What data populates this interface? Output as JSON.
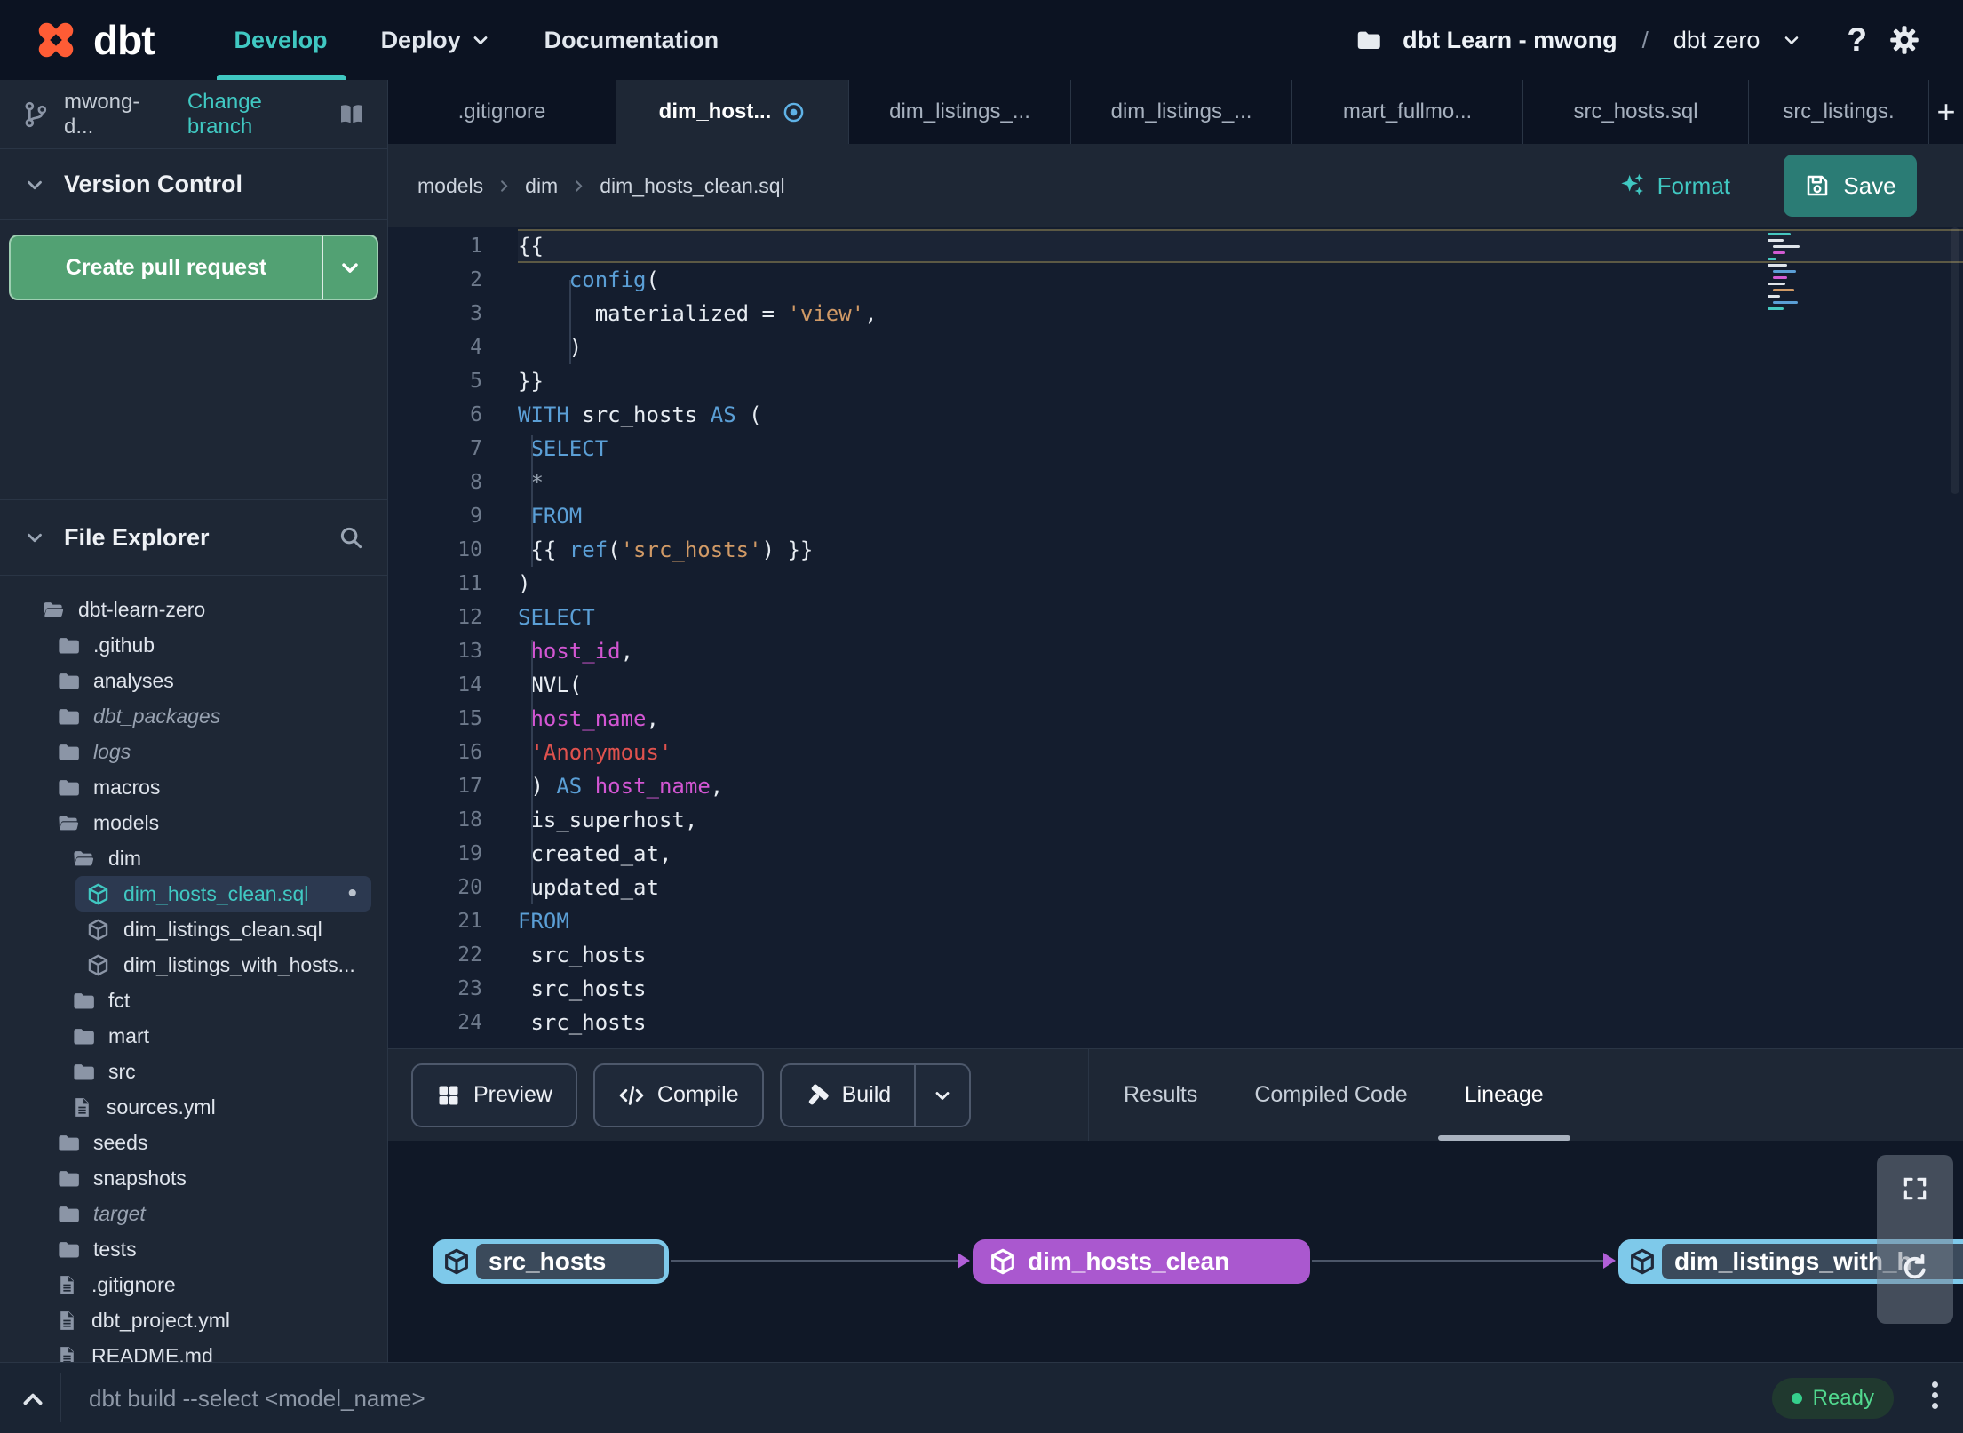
{
  "topnav": {
    "logo": "dbt",
    "menu": [
      {
        "label": "Develop",
        "active": true
      },
      {
        "label": "Deploy",
        "has_dropdown": true
      },
      {
        "label": "Documentation"
      }
    ],
    "project": {
      "icon": "folder-icon",
      "name": "dbt Learn - mwong",
      "separator": "/",
      "environment": "dbt zero"
    },
    "help_label": "?"
  },
  "sidebar": {
    "branch": {
      "icon": "git-branch-icon",
      "name": "mwong-d...",
      "change_label": "Change branch"
    },
    "version_control": {
      "title": "Version Control",
      "create_pr_label": "Create pull request"
    },
    "file_explorer": {
      "title": "File Explorer",
      "tree": [
        {
          "label": "dbt-learn-zero",
          "icon": "folder-open-icon",
          "depth": 0
        },
        {
          "label": ".github",
          "icon": "folder-icon",
          "depth": 1
        },
        {
          "label": "analyses",
          "icon": "folder-icon",
          "depth": 1
        },
        {
          "label": "dbt_packages",
          "icon": "folder-icon",
          "depth": 1,
          "italic": true
        },
        {
          "label": "logs",
          "icon": "folder-icon",
          "depth": 1,
          "italic": true
        },
        {
          "label": "macros",
          "icon": "folder-icon",
          "depth": 1
        },
        {
          "label": "models",
          "icon": "folder-open-icon",
          "depth": 1
        },
        {
          "label": "dim",
          "icon": "folder-open-icon",
          "depth": 2
        },
        {
          "label": "dim_hosts_clean.sql",
          "icon": "model-icon",
          "depth": 3,
          "selected": true,
          "modified": true
        },
        {
          "label": "dim_listings_clean.sql",
          "icon": "model-icon",
          "depth": 3
        },
        {
          "label": "dim_listings_with_hosts...",
          "icon": "model-icon",
          "depth": 3
        },
        {
          "label": "fct",
          "icon": "folder-icon",
          "depth": 2
        },
        {
          "label": "mart",
          "icon": "folder-icon",
          "depth": 2
        },
        {
          "label": "src",
          "icon": "folder-icon",
          "depth": 2
        },
        {
          "label": "sources.yml",
          "icon": "file-icon",
          "depth": 2
        },
        {
          "label": "seeds",
          "icon": "folder-icon",
          "depth": 1
        },
        {
          "label": "snapshots",
          "icon": "folder-icon",
          "depth": 1
        },
        {
          "label": "target",
          "icon": "folder-icon",
          "depth": 1,
          "italic": true
        },
        {
          "label": "tests",
          "icon": "folder-icon",
          "depth": 1
        },
        {
          "label": ".gitignore",
          "icon": "file-icon",
          "depth": 1
        },
        {
          "label": "dbt_project.yml",
          "icon": "file-icon",
          "depth": 1
        },
        {
          "label": "README.md",
          "icon": "file-icon",
          "depth": 1
        }
      ]
    }
  },
  "tab_strip": {
    "tabs": [
      {
        "label": ".gitignore"
      },
      {
        "label": "dim_host...",
        "active": true,
        "modified": true
      },
      {
        "label": "dim_listings_..."
      },
      {
        "label": "dim_listings_..."
      },
      {
        "label": "mart_fullmo..."
      },
      {
        "label": "src_hosts.sql"
      },
      {
        "label": "src_listings."
      }
    ],
    "new_tab_label": "+"
  },
  "toolbar": {
    "breadcrumb": [
      "models",
      "dim",
      "dim_hosts_clean.sql"
    ],
    "format_label": "Format",
    "save_label": "Save"
  },
  "editor": {
    "lines": [
      {
        "n": 1,
        "segs": [
          {
            "t": "{{",
            "c": "w"
          }
        ]
      },
      {
        "n": 2,
        "segs": [
          {
            "t": "    ",
            "c": "w"
          },
          {
            "t": "config",
            "c": "b"
          },
          {
            "t": "(",
            "c": "w"
          }
        ]
      },
      {
        "n": 3,
        "segs": [
          {
            "t": "      materialized = ",
            "c": "w"
          },
          {
            "t": "'view'",
            "c": "o"
          },
          {
            "t": ",",
            "c": "w"
          }
        ]
      },
      {
        "n": 4,
        "segs": [
          {
            "t": "    )",
            "c": "w"
          }
        ]
      },
      {
        "n": 5,
        "segs": [
          {
            "t": "}}",
            "c": "w"
          }
        ]
      },
      {
        "n": 6,
        "segs": [
          {
            "t": "WITH",
            "c": "b"
          },
          {
            "t": " src_hosts ",
            "c": "w"
          },
          {
            "t": "AS",
            "c": "b"
          },
          {
            "t": " (",
            "c": "w"
          }
        ]
      },
      {
        "n": 7,
        "segs": [
          {
            "t": " ",
            "c": "w"
          },
          {
            "t": "SELECT",
            "c": "b"
          }
        ]
      },
      {
        "n": 8,
        "segs": [
          {
            "t": " *",
            "c": "g"
          }
        ]
      },
      {
        "n": 9,
        "segs": [
          {
            "t": " ",
            "c": "w"
          },
          {
            "t": "FROM",
            "c": "b"
          }
        ]
      },
      {
        "n": 10,
        "segs": [
          {
            "t": " {{ ",
            "c": "w"
          },
          {
            "t": "ref",
            "c": "b"
          },
          {
            "t": "(",
            "c": "w"
          },
          {
            "t": "'src_hosts'",
            "c": "o"
          },
          {
            "t": ") }}",
            "c": "w"
          }
        ]
      },
      {
        "n": 11,
        "segs": [
          {
            "t": ")",
            "c": "w"
          }
        ]
      },
      {
        "n": 12,
        "segs": [
          {
            "t": "SELECT",
            "c": "b"
          }
        ]
      },
      {
        "n": 13,
        "segs": [
          {
            "t": " ",
            "c": "w"
          },
          {
            "t": "host_id",
            "c": "m"
          },
          {
            "t": ",",
            "c": "w"
          }
        ]
      },
      {
        "n": 14,
        "segs": [
          {
            "t": " NVL(",
            "c": "w"
          }
        ]
      },
      {
        "n": 15,
        "segs": [
          {
            "t": " ",
            "c": "w"
          },
          {
            "t": "host_name",
            "c": "m"
          },
          {
            "t": ",",
            "c": "w"
          }
        ]
      },
      {
        "n": 16,
        "segs": [
          {
            "t": " ",
            "c": "w"
          },
          {
            "t": "'Anonymous'",
            "c": "r"
          }
        ]
      },
      {
        "n": 17,
        "segs": [
          {
            "t": " ) ",
            "c": "w"
          },
          {
            "t": "AS",
            "c": "b"
          },
          {
            "t": " ",
            "c": "w"
          },
          {
            "t": "host_name",
            "c": "m"
          },
          {
            "t": ",",
            "c": "w"
          }
        ]
      },
      {
        "n": 18,
        "segs": [
          {
            "t": " is_superhost,",
            "c": "w"
          }
        ]
      },
      {
        "n": 19,
        "segs": [
          {
            "t": " created_at,",
            "c": "w"
          }
        ]
      },
      {
        "n": 20,
        "segs": [
          {
            "t": " updated_at",
            "c": "w"
          }
        ]
      },
      {
        "n": 21,
        "segs": [
          {
            "t": "FROM",
            "c": "b"
          }
        ]
      },
      {
        "n": 22,
        "segs": [
          {
            "t": " src_hosts",
            "c": "w"
          }
        ]
      },
      {
        "n": 23,
        "segs": [
          {
            "t": " src_hosts",
            "c": "w"
          }
        ]
      },
      {
        "n": 24,
        "segs": [
          {
            "t": " src_hosts",
            "c": "w"
          }
        ]
      }
    ]
  },
  "action_bar": {
    "buttons": [
      {
        "label": "Preview",
        "icon": "grid-icon"
      },
      {
        "label": "Compile",
        "icon": "code-icon"
      },
      {
        "label": "Build",
        "icon": "hammer-icon",
        "split": true
      }
    ],
    "tabs": [
      {
        "label": "Results"
      },
      {
        "label": "Compiled Code"
      },
      {
        "label": "Lineage",
        "active": true
      }
    ]
  },
  "lineage": {
    "nodes": [
      {
        "label": "src_hosts",
        "style": "source"
      },
      {
        "label": "dim_hosts_clean",
        "style": "model"
      },
      {
        "label": "dim_listings_with_h",
        "style": "source"
      }
    ],
    "controls": [
      "fullscreen-icon",
      "refresh-icon"
    ]
  },
  "command_bar": {
    "command": "dbt build --select <model_name>",
    "status": "Ready"
  },
  "colors": {
    "accent_teal": "#40c8c2",
    "logo_orange": "#ff5c35",
    "pr_green": "#52a173",
    "ready_green": "#52d98f",
    "modified_blue": "#5fb2e6",
    "node_blue": "#7ec9ea",
    "node_purple": "#aa58cf",
    "code_keyword": "#5b9fd6",
    "code_string": "#d19a66",
    "code_string_alt": "#e0524e",
    "code_column": "#d356d3"
  }
}
